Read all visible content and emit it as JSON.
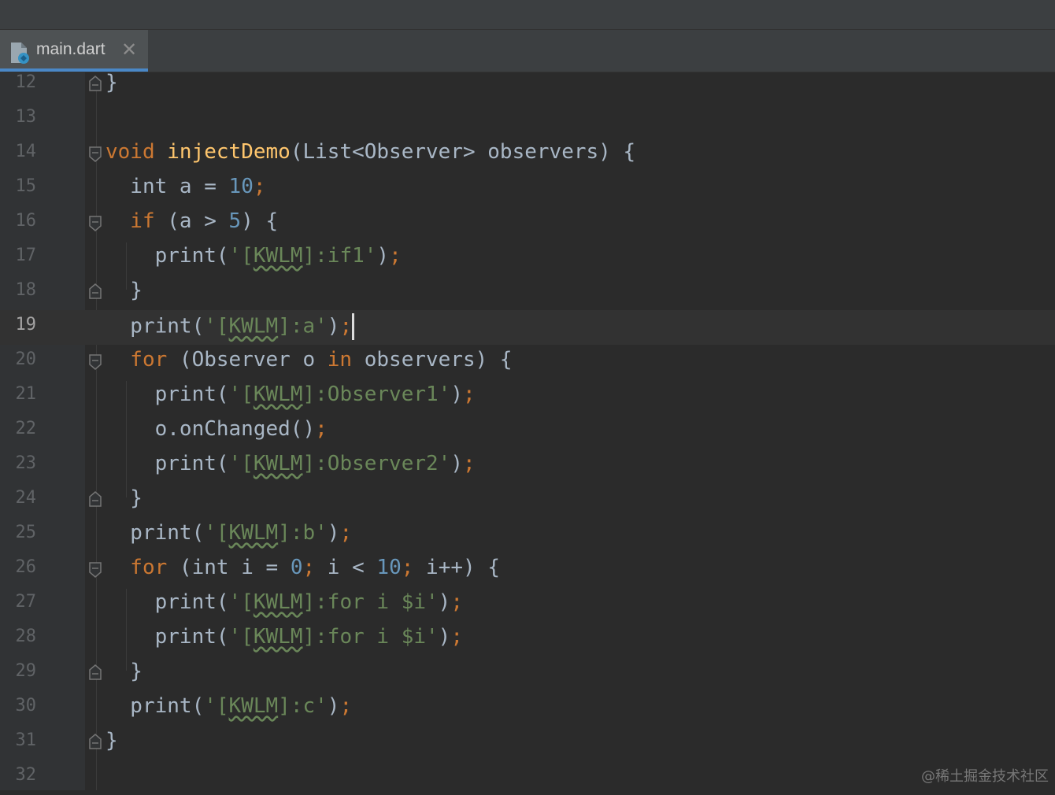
{
  "tab": {
    "filename": "main.dart",
    "close_glyph": "✕",
    "icon": "dart-file-icon"
  },
  "lines": [
    {
      "n": "12"
    },
    {
      "n": "13"
    },
    {
      "n": "14"
    },
    {
      "n": "15"
    },
    {
      "n": "16"
    },
    {
      "n": "17"
    },
    {
      "n": "18"
    },
    {
      "n": "19"
    },
    {
      "n": "20"
    },
    {
      "n": "21"
    },
    {
      "n": "22"
    },
    {
      "n": "23"
    },
    {
      "n": "24"
    },
    {
      "n": "25"
    },
    {
      "n": "26"
    },
    {
      "n": "27"
    },
    {
      "n": "28"
    },
    {
      "n": "29"
    },
    {
      "n": "30"
    },
    {
      "n": "31"
    },
    {
      "n": "32"
    }
  ],
  "code": {
    "l12": {
      "a": "}"
    },
    "l14": {
      "a": "void ",
      "b": "injectDemo",
      "c": "(List<Observer> observers) {"
    },
    "l15": {
      "a": "  int a = ",
      "b": "10",
      "c": ";"
    },
    "l16": {
      "a": "  if",
      "b": " (a > ",
      "c": "5",
      "d": ") {"
    },
    "l17": {
      "a": "    print(",
      "b": "'[",
      "c": "KWLM",
      "d": "]:if1'",
      "e": ")",
      "f": ";"
    },
    "l18": {
      "a": "  }"
    },
    "l19": {
      "a": "  print(",
      "b": "'[",
      "c": "KWLM",
      "d": "]:a'",
      "e": ")",
      "f": ";"
    },
    "l20": {
      "a": "  for",
      "b": " (Observer o ",
      "c": "in",
      "d": " observers) {"
    },
    "l21": {
      "a": "    print(",
      "b": "'[",
      "c": "KWLM",
      "d": "]:Observer1'",
      "e": ")",
      "f": ";"
    },
    "l22": {
      "a": "    o.onChanged()",
      "b": ";"
    },
    "l23": {
      "a": "    print(",
      "b": "'[",
      "c": "KWLM",
      "d": "]:Observer2'",
      "e": ")",
      "f": ";"
    },
    "l24": {
      "a": "  }"
    },
    "l25": {
      "a": "  print(",
      "b": "'[",
      "c": "KWLM",
      "d": "]:b'",
      "e": ")",
      "f": ";"
    },
    "l26": {
      "a": "  for",
      "b": " (int i = ",
      "c": "0",
      "d": "; ",
      "e": "i < ",
      "f": "10",
      "g": "; ",
      "h": "i++) {"
    },
    "l27": {
      "a": "    print(",
      "b": "'[",
      "c": "KWLM",
      "d": "]:for i $i'",
      "e": ")",
      "f": ";"
    },
    "l28": {
      "a": "    print(",
      "b": "'[",
      "c": "KWLM",
      "d": "]:for i $i'",
      "e": ")",
      "f": ";"
    },
    "l29": {
      "a": "  }"
    },
    "l30": {
      "a": "  print(",
      "b": "'[",
      "c": "KWLM",
      "d": "]:c'",
      "e": ")",
      "f": ";"
    },
    "l31": {
      "a": "}"
    }
  },
  "current_line": "19",
  "watermark": "@稀土掘金技术社区",
  "colors": {
    "keyword": "#cc7832",
    "function": "#ffc66d",
    "number": "#6897bb",
    "string": "#6a8759",
    "text": "#a9b7c6",
    "background": "#2b2b2b",
    "tab_accent": "#4a88c7"
  }
}
